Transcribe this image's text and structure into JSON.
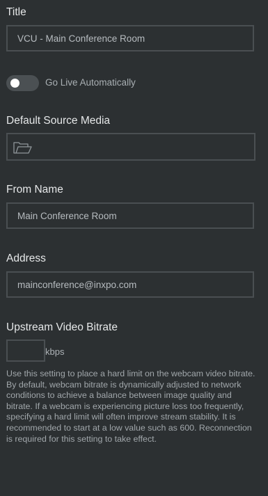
{
  "form": {
    "title_label": "Title",
    "title_value": "VCU - Main Conference Room",
    "go_live_label": "Go Live Automatically",
    "go_live_enabled": false,
    "default_source_label": "Default Source Media",
    "from_name_label": "From Name",
    "from_name_value": "Main Conference Room",
    "address_label": "Address",
    "address_value": "mainconference@inxpo.com",
    "bitrate_label": "Upstream Video Bitrate",
    "bitrate_value": "",
    "bitrate_unit": "kbps",
    "help_text": "Use this setting to place a hard limit on the webcam video bitrate. By default, webcam bitrate is dynamically adjusted to network conditions to achieve a balance between image quality and bitrate. If a webcam is experiencing picture loss too frequently, specifying a hard limit will often improve stream stability. It is recommended to start at a low value such as 600. Reconnection is required for this setting to take effect."
  },
  "icons": {
    "media": "folder-icon"
  },
  "colors": {
    "background": "#2c3032",
    "border": "#4a4f52",
    "label": "#e6e8e9",
    "muted_text": "#a1a7ab",
    "toggle_track": "#4b5053",
    "toggle_knob": "#ffffff"
  }
}
